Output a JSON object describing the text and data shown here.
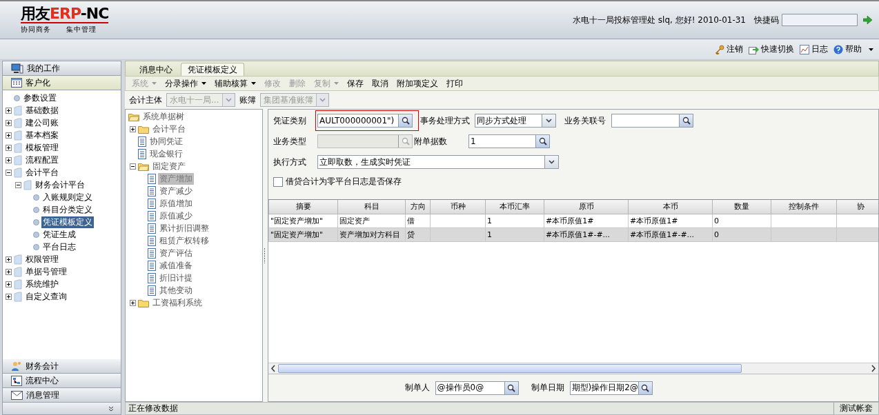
{
  "header": {
    "logo": {
      "brand": "用友",
      "product": "ERP",
      "suffix": "-NC",
      "tagline_left": "协同商务",
      "tagline_right": "集中管理"
    },
    "greeting": "水电十一局投标管理处 slq, 您好! 2010-01-31",
    "shortcut_label": "快捷码"
  },
  "top_links": [
    "注销",
    "快速切换",
    "日志",
    "帮助"
  ],
  "sidebar": {
    "panels": [
      {
        "label": "我的工作",
        "selected": false
      },
      {
        "label": "客户化",
        "selected": true
      },
      {
        "label": "财务会计",
        "selected": false
      },
      {
        "label": "流程中心",
        "selected": false
      },
      {
        "label": "消息管理",
        "selected": false
      }
    ],
    "tree": [
      {
        "label": "参数设置",
        "kind": "bullet",
        "selected": false
      },
      {
        "label": "基础数据",
        "kind": "page",
        "expanded": false,
        "selected": false
      },
      {
        "label": "建公司账",
        "kind": "page",
        "expanded": false,
        "selected": false
      },
      {
        "label": "基本档案",
        "kind": "page",
        "expanded": false,
        "selected": false
      },
      {
        "label": "模板管理",
        "kind": "page",
        "expanded": false,
        "selected": false
      },
      {
        "label": "流程配置",
        "kind": "page",
        "expanded": false,
        "selected": false
      },
      {
        "label": "会计平台",
        "kind": "page",
        "expanded": true,
        "selected": false,
        "children": [
          {
            "label": "财务会计平台",
            "kind": "page",
            "expanded": true,
            "selected": false,
            "children": [
              {
                "label": "入账规则定义",
                "kind": "bullet",
                "selected": false
              },
              {
                "label": "科目分类定义",
                "kind": "bullet",
                "selected": false
              },
              {
                "label": "凭证模板定义",
                "kind": "bullet",
                "selected": true
              },
              {
                "label": "凭证生成",
                "kind": "bullet",
                "selected": false
              },
              {
                "label": "平台日志",
                "kind": "bullet",
                "selected": false
              }
            ]
          }
        ]
      },
      {
        "label": "权限管理",
        "kind": "page",
        "expanded": false,
        "selected": false
      },
      {
        "label": "单据号管理",
        "kind": "page",
        "expanded": false,
        "selected": false
      },
      {
        "label": "系统维护",
        "kind": "page",
        "expanded": false,
        "selected": false
      },
      {
        "label": "自定义查询",
        "kind": "page",
        "expanded": false,
        "selected": false
      }
    ]
  },
  "tabs": [
    {
      "label": "消息中心",
      "selected": false
    },
    {
      "label": "凭证模板定义",
      "selected": true
    }
  ],
  "toolbar": [
    {
      "label": "系统",
      "disabled": true,
      "dropdown": true
    },
    {
      "label": "分录操作",
      "disabled": false,
      "dropdown": true
    },
    {
      "label": "辅助核算",
      "disabled": false,
      "dropdown": true
    },
    {
      "label": "修改",
      "disabled": true,
      "dropdown": false
    },
    {
      "label": "删除",
      "disabled": true,
      "dropdown": false
    },
    {
      "label": "复制",
      "disabled": true,
      "dropdown": true
    },
    {
      "label": "保存",
      "disabled": false,
      "dropdown": false
    },
    {
      "label": "取消",
      "disabled": false,
      "dropdown": false
    },
    {
      "label": "附加项定义",
      "disabled": false,
      "dropdown": false
    },
    {
      "label": "打印",
      "disabled": false,
      "dropdown": false
    }
  ],
  "filter_bar": [
    {
      "label": "会计主体",
      "value": "水电十一局...",
      "disabled": true
    },
    {
      "label": "账簿",
      "value": "集团基准账簿",
      "disabled": true
    }
  ],
  "bill_tree": {
    "label": "系统单据树",
    "kind": "folder",
    "children": [
      {
        "label": "会计平台",
        "kind": "folder",
        "expanded": false,
        "selected": false
      },
      {
        "label": "协同凭证",
        "kind": "sheet",
        "selected": false
      },
      {
        "label": "现金银行",
        "kind": "sheet",
        "selected": false
      },
      {
        "label": "固定资产",
        "kind": "folder",
        "expanded": true,
        "selected": false,
        "children": [
          {
            "label": "资产增加",
            "kind": "sheet",
            "selected": true
          },
          {
            "label": "资产减少",
            "kind": "sheet",
            "selected": false
          },
          {
            "label": "原值增加",
            "kind": "sheet",
            "selected": false
          },
          {
            "label": "原值减少",
            "kind": "sheet",
            "selected": false
          },
          {
            "label": "累计折旧调整",
            "kind": "sheet",
            "selected": false
          },
          {
            "label": "租赁产权转移",
            "kind": "sheet",
            "selected": false
          },
          {
            "label": "资产评估",
            "kind": "sheet",
            "selected": false
          },
          {
            "label": "减值准备",
            "kind": "sheet",
            "selected": false
          },
          {
            "label": "折旧计提",
            "kind": "sheet",
            "selected": false
          },
          {
            "label": "其他变动",
            "kind": "sheet",
            "selected": false
          }
        ]
      },
      {
        "label": "工资福利系统",
        "kind": "folder",
        "expanded": false,
        "selected": false
      }
    ]
  },
  "form": {
    "rows": [
      [
        {
          "label": "凭证类别",
          "kind": "lookup",
          "value": "AULT000000001\")",
          "highlighted": true,
          "disabled": false
        },
        {
          "label": "事务处理方式",
          "kind": "select",
          "value": "同步方式处理",
          "highlighted": false,
          "disabled": false
        },
        {
          "label": "业务关联号",
          "kind": "lookup",
          "highlighted": false,
          "disabled": false
        }
      ],
      [
        {
          "label": "业务类型",
          "kind": "lookup",
          "highlighted": false,
          "disabled": true
        },
        {
          "label": "附单据数",
          "kind": "lookup",
          "value": "1",
          "highlighted": false,
          "disabled": false
        }
      ],
      [
        {
          "label": "执行方式",
          "kind": "select",
          "value": "立即取数，生成实时凭证",
          "highlighted": false,
          "disabled": false
        }
      ]
    ],
    "checkbox": {
      "label": "借贷合计为零平台日志是否保存",
      "checked": false
    }
  },
  "table": {
    "columns": [
      "摘要",
      "科目",
      "方向",
      "币种",
      "本币汇率",
      "原币",
      "本币",
      "数量",
      "控制条件",
      "协"
    ],
    "rows": [
      {
        "selected": false,
        "cells": [
          "\"固定资产增加\"",
          "固定资产",
          "借",
          null,
          "1",
          "#本币原值1#",
          "#本币原值1#",
          "0",
          null,
          null
        ]
      },
      {
        "selected": true,
        "cells": [
          "\"固定资产增加\"",
          "资产增加对方科目",
          "贷",
          null,
          "1",
          "#本币原值1#-#...",
          "#本币原值1#-#...",
          "0",
          null,
          null
        ]
      }
    ]
  },
  "footer": [
    {
      "label": "制单人",
      "value": "@操作员0@"
    },
    {
      "label": "制单日期",
      "value": "期型)操作日期2@"
    }
  ],
  "status_bar": {
    "message": "正在修改数据",
    "account": "测试帐套"
  }
}
